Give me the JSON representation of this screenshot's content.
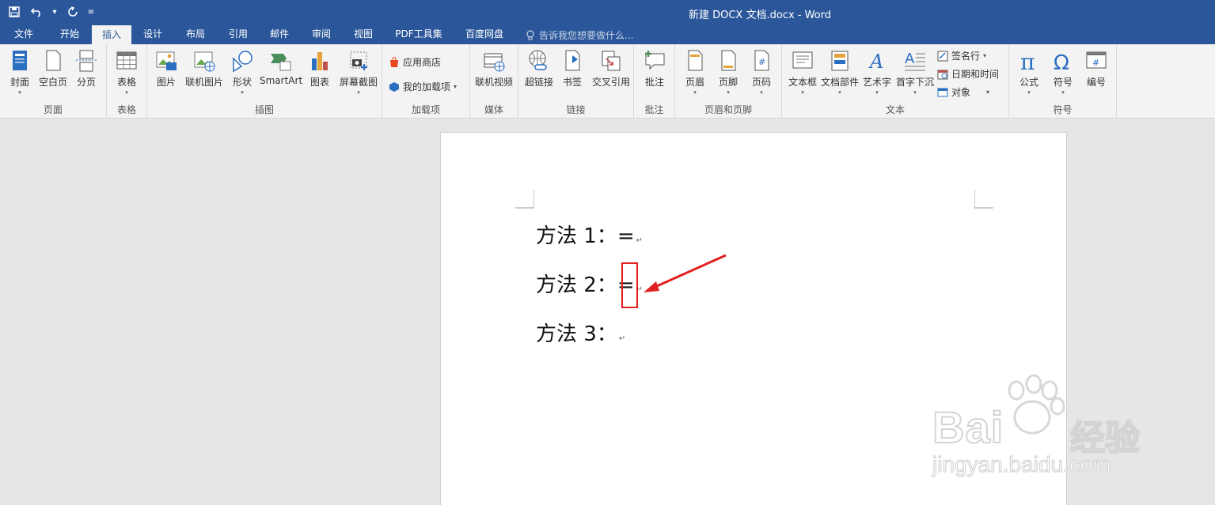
{
  "window": {
    "title": "新建 DOCX 文档.docx - Word"
  },
  "qat": {
    "save_icon": "save-icon",
    "undo_icon": "undo-icon",
    "redo_icon": "redo-icon"
  },
  "tabs": [
    "文件",
    "开始",
    "插入",
    "设计",
    "布局",
    "引用",
    "邮件",
    "审阅",
    "视图",
    "PDF工具集",
    "百度网盘"
  ],
  "active_tab": "插入",
  "tell_me": "告诉我您想要做什么...",
  "ribbon": {
    "groups": {
      "pages": "页面",
      "tables": "表格",
      "illustrations": "插图",
      "addins": "加载项",
      "media": "媒体",
      "links": "链接",
      "comments": "批注",
      "header_footer": "页眉和页脚",
      "text": "文本",
      "symbols": "符号"
    },
    "buttons": {
      "cover": "封面",
      "blank_page": "空白页",
      "page_break": "分页",
      "table": "表格",
      "pictures": "图片",
      "online_pictures": "联机图片",
      "shapes": "形状",
      "smartart": "SmartArt",
      "chart": "图表",
      "screenshot": "屏幕截图",
      "store": "应用商店",
      "my_addins": "我的加载项",
      "online_video": "联机视频",
      "hyperlink": "超链接",
      "bookmark": "书签",
      "cross_ref": "交叉引用",
      "comment": "批注",
      "header": "页眉",
      "footer": "页脚",
      "page_number": "页码",
      "text_box": "文本框",
      "quick_parts": "文档部件",
      "wordart": "艺术字",
      "drop_cap": "首字下沉",
      "signature": "签名行",
      "datetime": "日期和时间",
      "object": "对象",
      "equation": "公式",
      "symbol": "符号",
      "numbering": "编号"
    }
  },
  "document": {
    "lines": [
      {
        "label": "方法 1：",
        "value": "="
      },
      {
        "label": "方法 2：",
        "value": "="
      },
      {
        "label": "方法 3：",
        "value": ""
      }
    ],
    "para_mark": "↵"
  },
  "watermark": {
    "brand": "Bai",
    "brand_cn": "经验",
    "url": "jingyan.baidu.com"
  },
  "colors": {
    "accent": "#2b579a",
    "highlight": "#e02020"
  }
}
